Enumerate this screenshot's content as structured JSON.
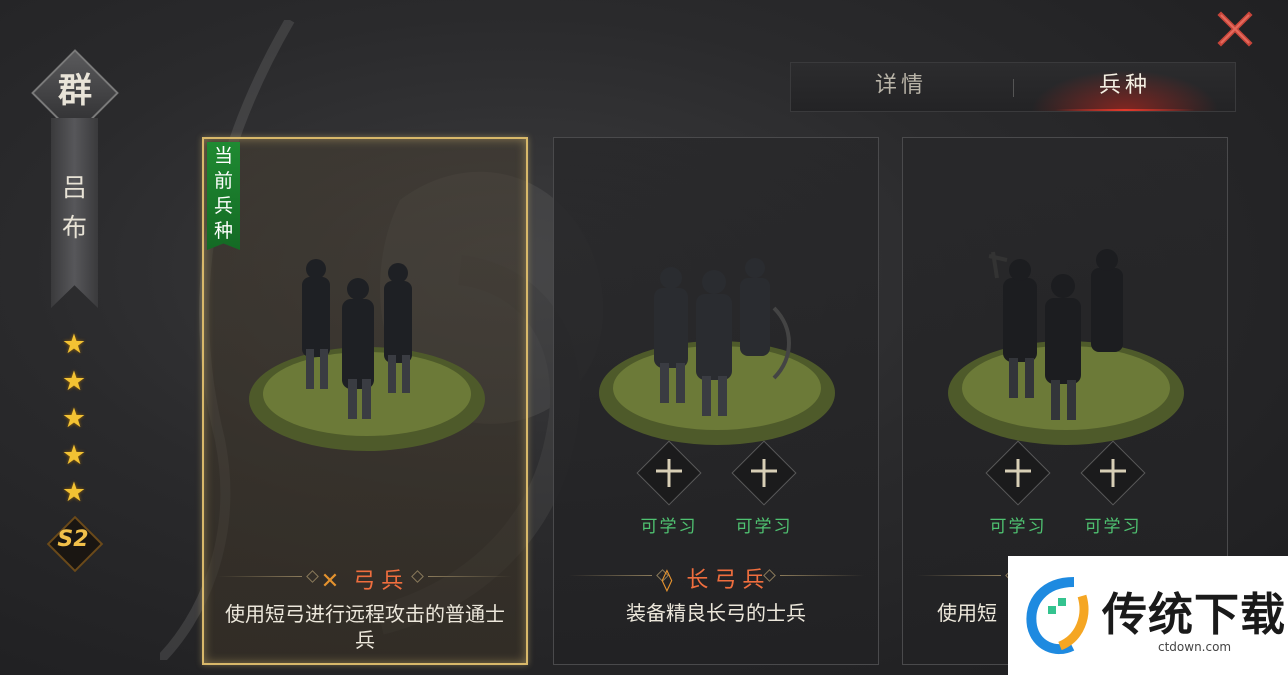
{
  "hero": {
    "faction": "群",
    "name_chars": [
      "吕",
      "布"
    ],
    "stars": [
      "★",
      "★",
      "★",
      "★",
      "★"
    ],
    "season": "S2"
  },
  "close_icon": "close-icon",
  "tabs": [
    {
      "label": "详情",
      "active": false
    },
    {
      "label": "兵种",
      "active": true
    }
  ],
  "units": [
    {
      "name": "弓兵",
      "icon": "bow-icon",
      "current": true,
      "current_tag": [
        "当",
        "前",
        "兵",
        "种"
      ],
      "description": "使用短弓进行远程攻击的普通士兵",
      "learnable": []
    },
    {
      "name": "长弓兵",
      "icon": "longbow-icon",
      "current": false,
      "description": "装备精良长弓的士兵",
      "learnable": [
        "可学习",
        "可学习"
      ]
    },
    {
      "name": "",
      "current": false,
      "description": "使用短",
      "learnable": [
        "可学习",
        "可学习"
      ]
    }
  ],
  "watermark": {
    "title": "传统下载",
    "url": "ctdown.com"
  },
  "colors": {
    "accent_red": "#e23a2c",
    "gold_border": "#d8b86a",
    "learn_green": "#4fc271",
    "current_green": "#1f8a32",
    "star_gold": "#f3c233"
  }
}
